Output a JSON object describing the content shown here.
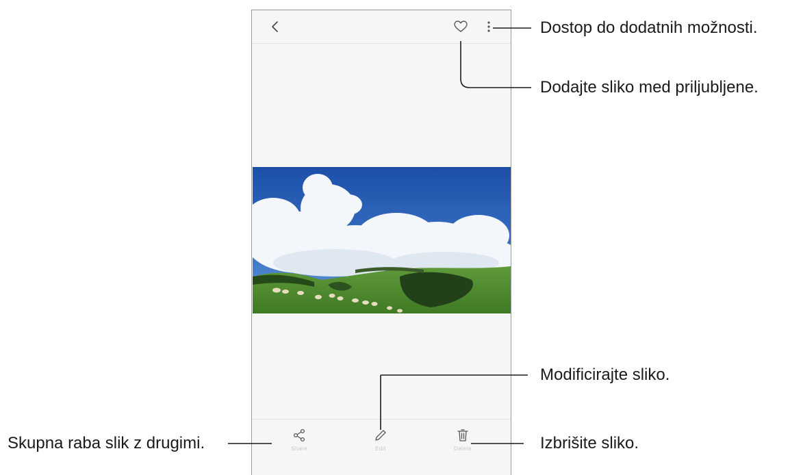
{
  "callouts": {
    "more_options": "Dostop do dodatnih možnosti.",
    "favorite": "Dodajte sliko med priljubljene.",
    "edit": "Modificirajte sliko.",
    "share": "Skupna raba slik z drugimi.",
    "delete": "Izbrišite sliko."
  },
  "bottom_bar": {
    "share_label": "Share",
    "edit_label": "Edit",
    "delete_label": "Delete"
  },
  "icons": {
    "back": "chevron-left-icon",
    "favorite": "heart-outline-icon",
    "more": "more-vertical-icon",
    "share": "share-icon",
    "edit": "pencil-icon",
    "delete": "trash-icon"
  },
  "colors": {
    "screen_background": "#f6f6f6",
    "icon": "#555555",
    "leader_line": "#1a1a1a"
  }
}
